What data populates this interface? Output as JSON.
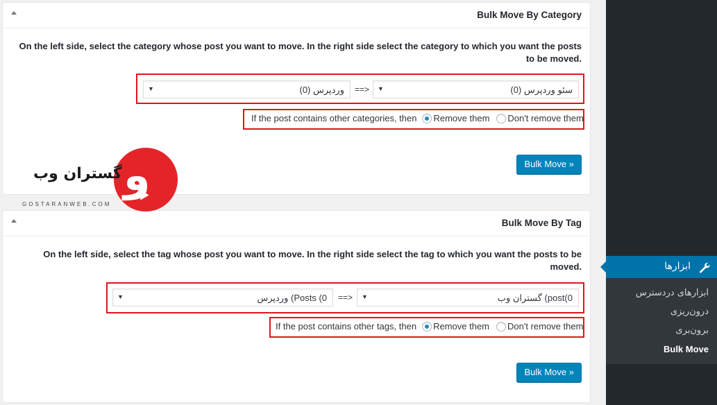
{
  "category_box": {
    "title": "Bulk Move By Category",
    "description": "On the left side, select the category whose post you want to move. In the right side select the category to which you want the posts to be moved.",
    "source_select": "سئو وردپرس  (0)",
    "arrow": "==>",
    "target_select": "وردپرس  (0)",
    "option_text": "If the post contains other categories, then",
    "remove_label": "Remove them",
    "dont_remove_label": "Don't remove them",
    "button": "Bulk Move »"
  },
  "tag_box": {
    "title": "Bulk Move By Tag",
    "description": "On the left side, select the tag whose post you want to move. In the right side select the tag to which you want the posts to be moved.",
    "source_select": "گستران وب (post(0",
    "arrow": "==>",
    "target_select": "وردپرس (Posts (0",
    "option_text": "If the post contains other tags, then",
    "remove_label": "Remove them",
    "dont_remove_label": "Don't remove them",
    "button": "Bulk Move »"
  },
  "watermark": {
    "brand": "گستران وب",
    "url": "GOSTARANWEB.COM"
  },
  "sidebar": {
    "active_menu": "ابزارها",
    "items": [
      {
        "label": "ابزارهای دردسترس"
      },
      {
        "label": "درون‌ریزی"
      },
      {
        "label": "برون‌بری"
      },
      {
        "label": "Bulk Move"
      }
    ]
  },
  "colors": {
    "accent": "#0073aa",
    "button": "#0085ba",
    "highlight": "#e0141c",
    "sidebar": "#23282d"
  }
}
